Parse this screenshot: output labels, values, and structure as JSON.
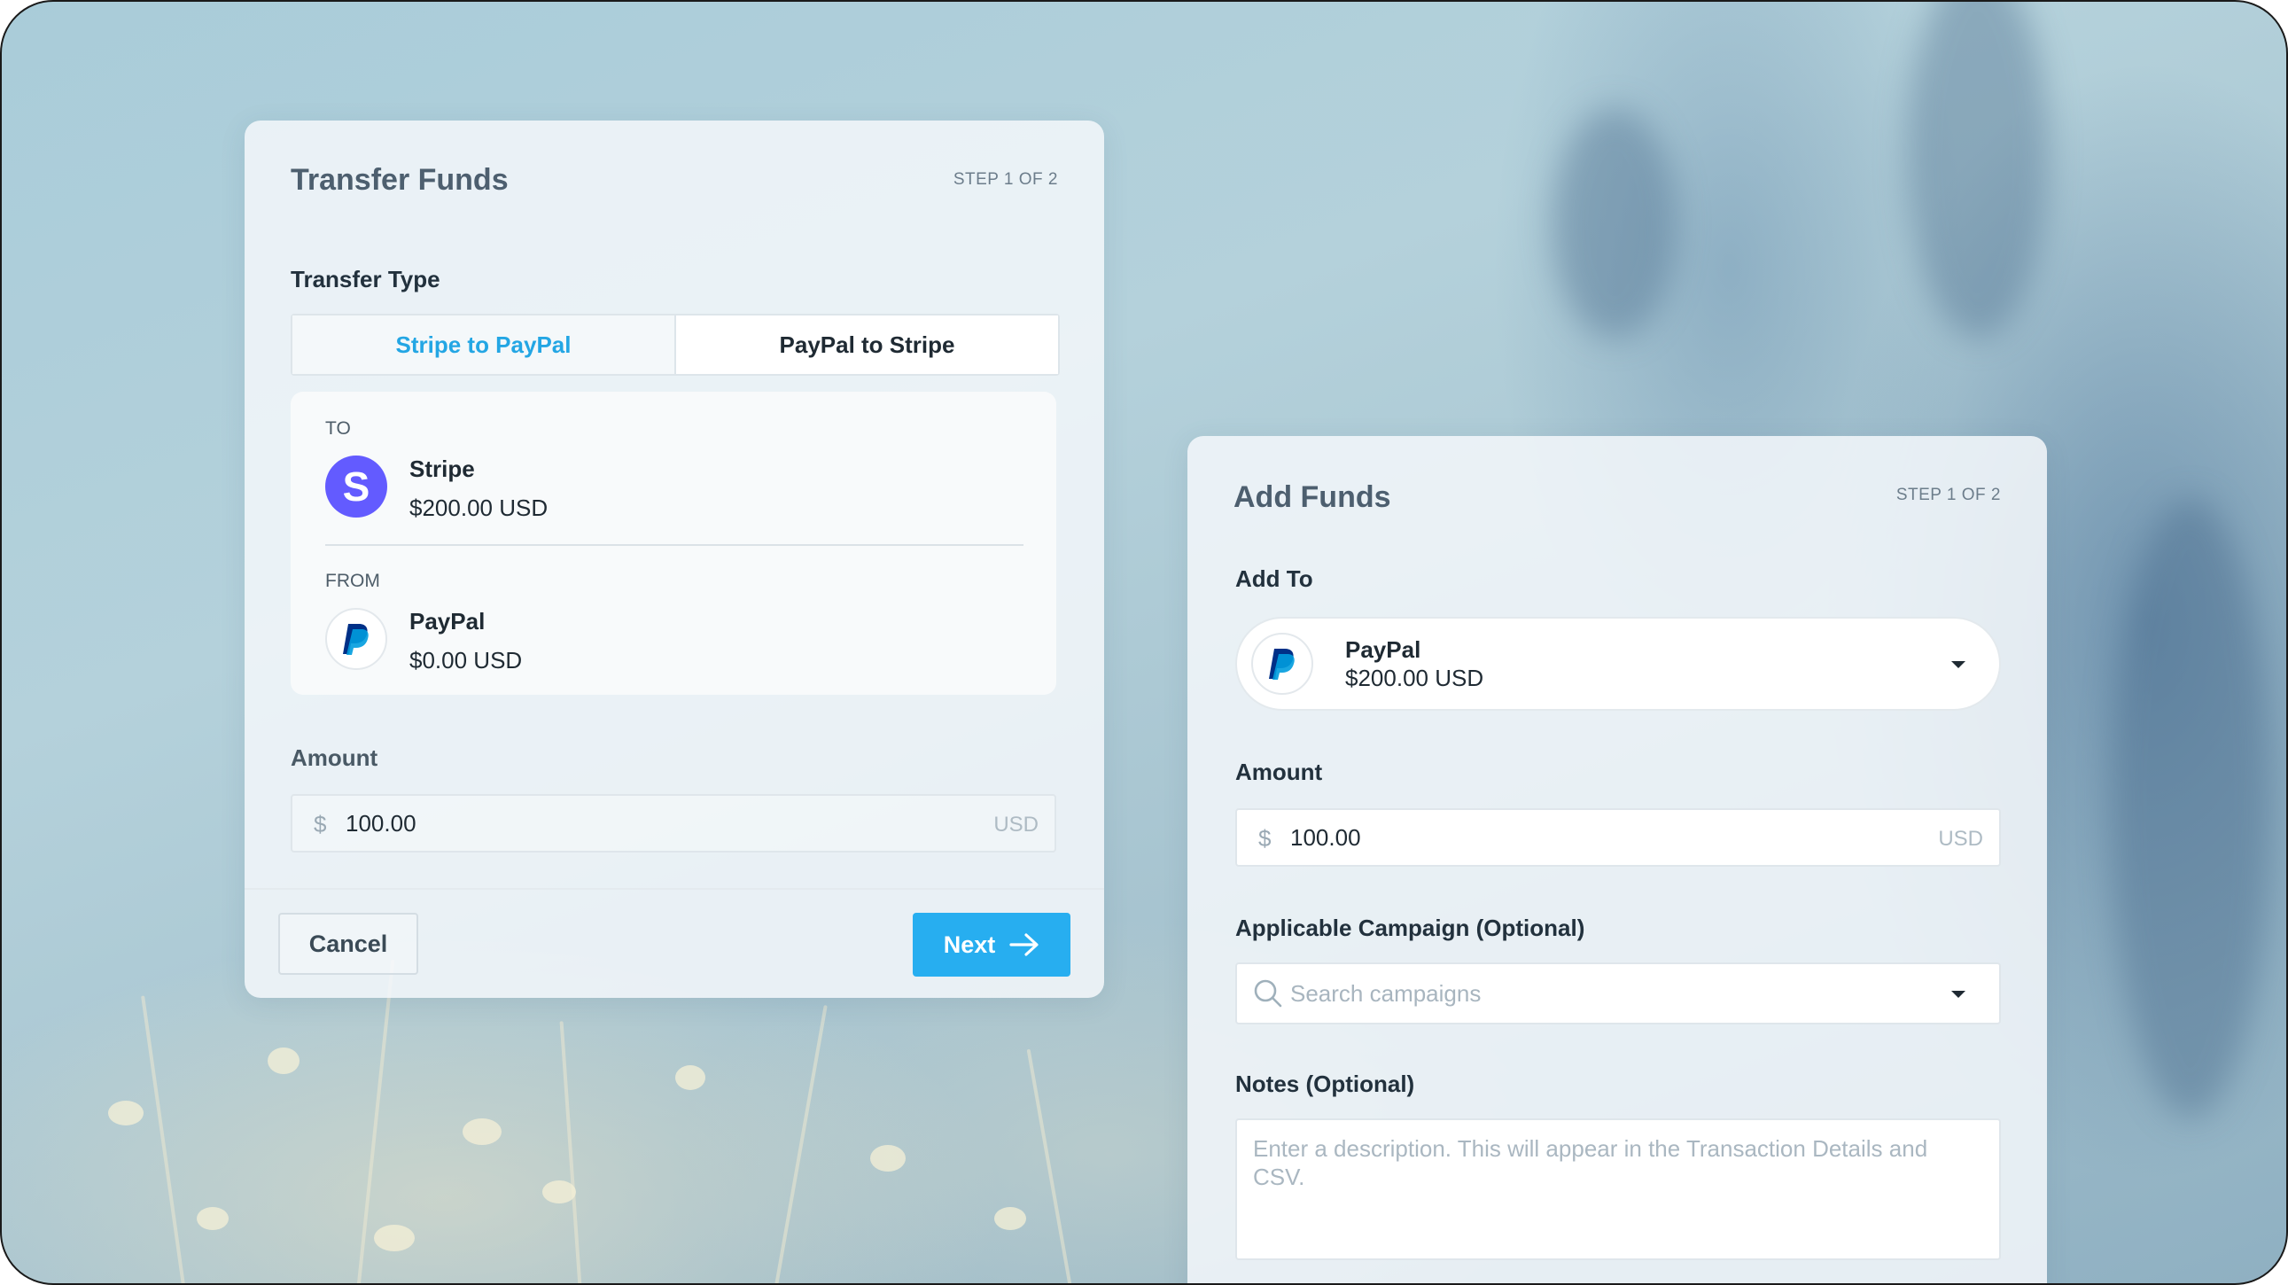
{
  "transfer_panel": {
    "title": "Transfer Funds",
    "step": "STEP 1 OF 2",
    "transfer_type_label": "Transfer Type",
    "options": [
      {
        "label": "Stripe to PayPal",
        "selected": true
      },
      {
        "label": "PayPal to Stripe",
        "selected": false
      }
    ],
    "to": {
      "caption": "TO",
      "name": "Stripe",
      "balance": "$200.00 USD",
      "logo_letter": "S",
      "icon": "stripe-logo-icon"
    },
    "from": {
      "caption": "FROM",
      "name": "PayPal",
      "balance": "$0.00 USD",
      "icon": "paypal-logo-icon"
    },
    "amount_label": "Amount",
    "amount": {
      "symbol": "$",
      "value": "100.00",
      "currency": "USD"
    },
    "cancel_label": "Cancel",
    "next_label": "Next",
    "next_icon": "arrow-right-icon"
  },
  "add_funds_panel": {
    "title": "Add Funds",
    "step": "STEP 1 OF 2",
    "add_to_label": "Add To",
    "add_to": {
      "name": "PayPal",
      "balance": "$200.00 USD",
      "icon": "paypal-logo-icon"
    },
    "amount_label": "Amount",
    "amount": {
      "symbol": "$",
      "value": "100.00",
      "currency": "USD"
    },
    "campaign_label": "Applicable Campaign (Optional)",
    "campaign_placeholder": "Search campaigns",
    "notes_label": "Notes (Optional)",
    "notes_placeholder": "Enter a description. This will appear in the Transaction Details and CSV."
  },
  "colors": {
    "accent": "#27aef0",
    "active_tab_text": "#23a6e4",
    "stripe_brand": "#635bff",
    "paypal_dark": "#003087",
    "paypal_light": "#009cde"
  }
}
